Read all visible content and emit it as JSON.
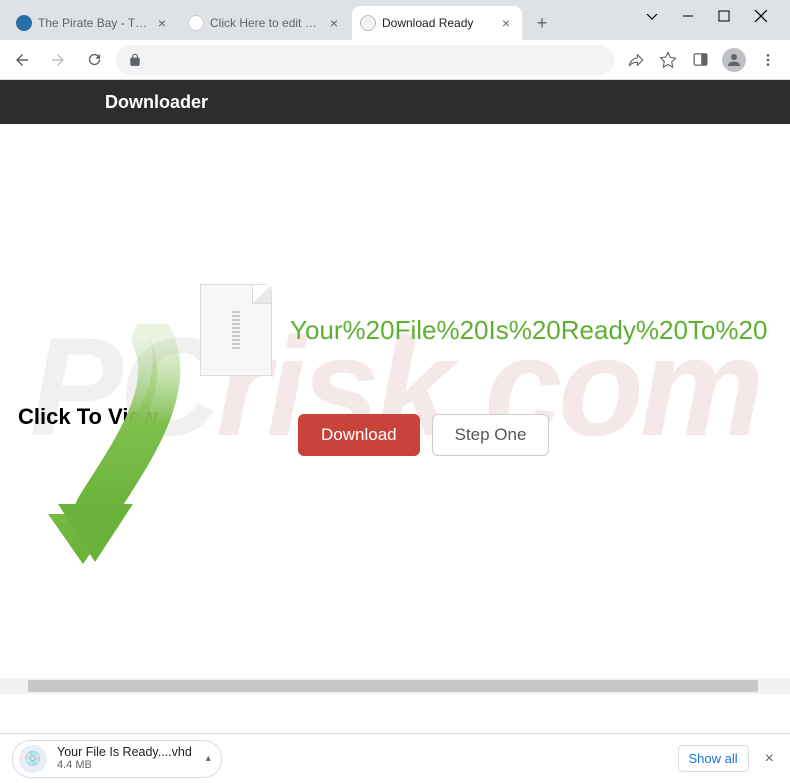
{
  "window": {
    "tabs": [
      {
        "title": "The Pirate Bay - The gal"
      },
      {
        "title": "Click Here to edit your L"
      },
      {
        "title": "Download Ready"
      }
    ],
    "active_tab_index": 2
  },
  "page": {
    "header_title": "Downloader",
    "file_ready_text": "Your%20File%20Is%20Ready%20To%20",
    "click_to_view": "Click To View",
    "download_button": "Download",
    "step_one_button": "Step One",
    "watermark_left": "PC",
    "watermark_right": "risk.com"
  },
  "downloads": {
    "item": {
      "name": "Your File Is Ready....vhd",
      "size": "4.4 MB"
    },
    "show_all": "Show all"
  }
}
